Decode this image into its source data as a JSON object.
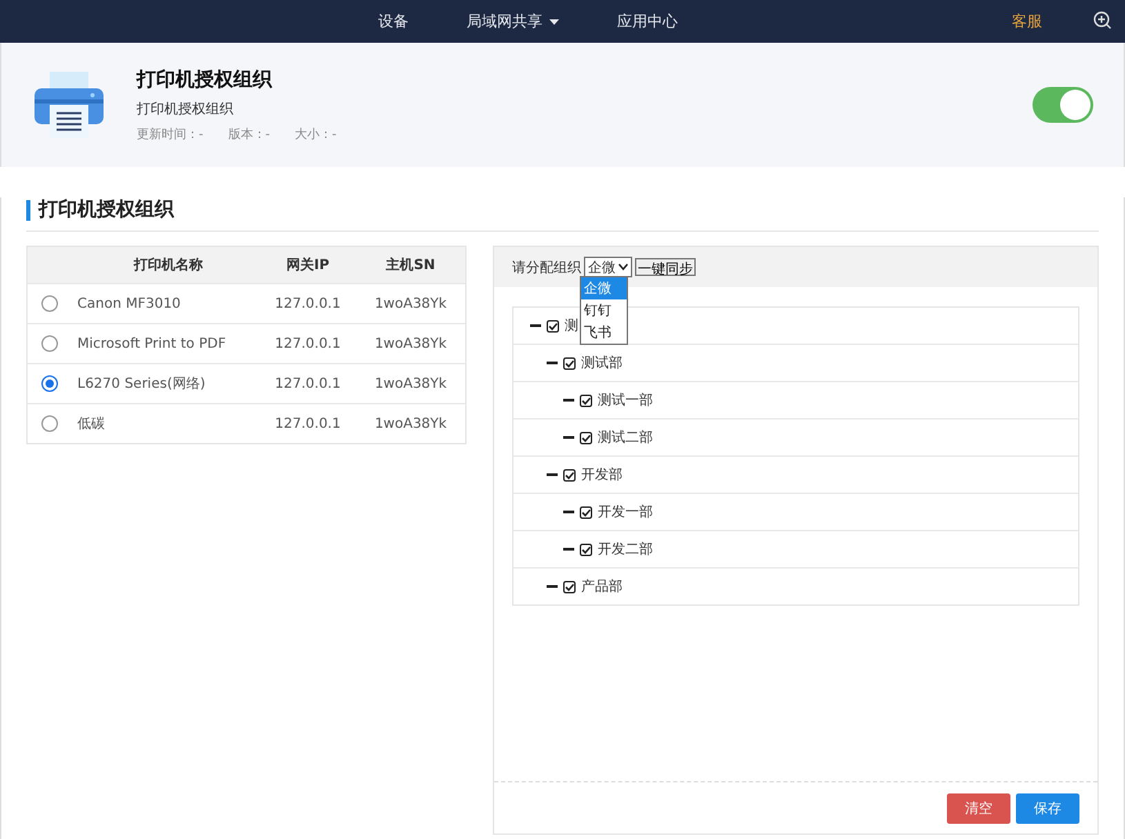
{
  "nav": {
    "items": [
      {
        "label": "设备",
        "dropdown": false
      },
      {
        "label": "局域网共享",
        "dropdown": true
      },
      {
        "label": "应用中心",
        "dropdown": false
      }
    ],
    "service": "客服"
  },
  "app": {
    "title": "打印机授权组织",
    "subtitle": "打印机授权组织",
    "meta": [
      "更新时间：-",
      "版本：-",
      "大小：-"
    ],
    "enabled": true
  },
  "section_title": "打印机授权组织",
  "printers": {
    "columns": [
      "打印机名称",
      "网关IP",
      "主机SN"
    ],
    "rows": [
      {
        "name": "Canon MF3010",
        "ip": "127.0.0.1",
        "sn": "1woA38Yk",
        "selected": false
      },
      {
        "name": "Microsoft Print to PDF",
        "ip": "127.0.0.1",
        "sn": "1woA38Yk",
        "selected": false
      },
      {
        "name": "L6270 Series(网络)",
        "ip": "127.0.0.1",
        "sn": "1woA38Yk",
        "selected": true
      },
      {
        "name": "低碳",
        "ip": "127.0.0.1",
        "sn": "1woA38Yk",
        "selected": false
      }
    ]
  },
  "org": {
    "label": "请分配组织",
    "select_value": "企微",
    "options": [
      {
        "label": "企微",
        "selected": true
      },
      {
        "label": "钉钉",
        "selected": false
      },
      {
        "label": "飞书",
        "selected": false
      }
    ],
    "sync_button": "一键同步",
    "tree": [
      {
        "label": "测",
        "expanded": true,
        "checked": true,
        "children": [
          {
            "label": "测试部",
            "expanded": true,
            "checked": true,
            "children": [
              {
                "label": "测试一部",
                "expanded": true,
                "checked": true
              },
              {
                "label": "测试二部",
                "expanded": true,
                "checked": true
              }
            ]
          },
          {
            "label": "开发部",
            "expanded": true,
            "checked": true,
            "children": [
              {
                "label": "开发一部",
                "expanded": true,
                "checked": true
              },
              {
                "label": "开发二部",
                "expanded": true,
                "checked": true
              }
            ]
          },
          {
            "label": "产品部",
            "expanded": true,
            "checked": true
          }
        ]
      }
    ],
    "buttons": [
      {
        "label": "清空",
        "kind": "danger"
      },
      {
        "label": "保存",
        "kind": "primary"
      }
    ]
  }
}
